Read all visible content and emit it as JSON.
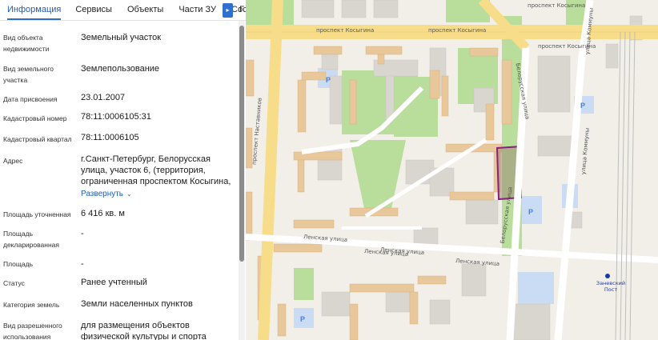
{
  "tabs": [
    {
      "label": "Информация",
      "active": true
    },
    {
      "label": "Сервисы",
      "active": false
    },
    {
      "label": "Объекты",
      "active": false
    },
    {
      "label": "Части ЗУ",
      "active": false
    },
    {
      "label": "Соста",
      "active": false
    }
  ],
  "tab_overflow_label": "Г",
  "tab_next_icon": "arrow-right-icon",
  "fields": [
    {
      "label": "Вид объекта недвижимости",
      "value": "Земельный участок"
    },
    {
      "label": "Вид земельного участка",
      "value": "Землепользование"
    },
    {
      "label": "Дата присвоения",
      "value": "23.01.2007"
    },
    {
      "label": "Кадастровый номер",
      "value": "78:11:0006105:31"
    },
    {
      "label": "Кадастровый квартал",
      "value": "78:11:0006105"
    },
    {
      "label": "Адрес",
      "value": "г.Санкт-Петербург, Белорусская улица, участок 6, (территория, ограниченная проспектом Косыгина,",
      "expand_label": "Развернуть"
    },
    {
      "label": "Площадь уточненная",
      "value": "6 416 кв. м"
    },
    {
      "label": "Площадь декларированная",
      "value": "-"
    },
    {
      "label": "Площадь",
      "value": "-"
    },
    {
      "label": "Статус",
      "value": "Ранее учтенный"
    },
    {
      "label": "Категория земель",
      "value": "Земли населенных пунктов"
    },
    {
      "label": "Вид разрешенного использования",
      "value": "для размещения объектов физической культуры и спорта"
    }
  ],
  "map": {
    "streets": {
      "kosygina_1": "проспект Косыгина",
      "kosygina_2": "проспект Косыгина",
      "kosygina_3": "проспект Косыгина",
      "kosygina_4": "проспект Косыгина",
      "nastavnikov": "проспект Наставников",
      "belorusskaya": "Белорусская улица",
      "belorusskaya_2": "Белорусская улица",
      "lenskaya_1": "Ленская улица",
      "lenskaya_2": "Ленская улица",
      "lenskaya_3": "Ленская улица",
      "lenskaya_4": "Ленская улица",
      "kommuny": "улица Коммуны",
      "kommuny_2": "улица Коммуны"
    },
    "station": "Заневский Пост",
    "parking_symbol": "P",
    "colors": {
      "highlight_parcel": "#8b1f7a",
      "main_road": "#f7dd8a",
      "green": "#b9dd9a",
      "building": "#d9d6d0",
      "building_accent": "#e8c79a",
      "parking": "#c9dcf3"
    }
  }
}
